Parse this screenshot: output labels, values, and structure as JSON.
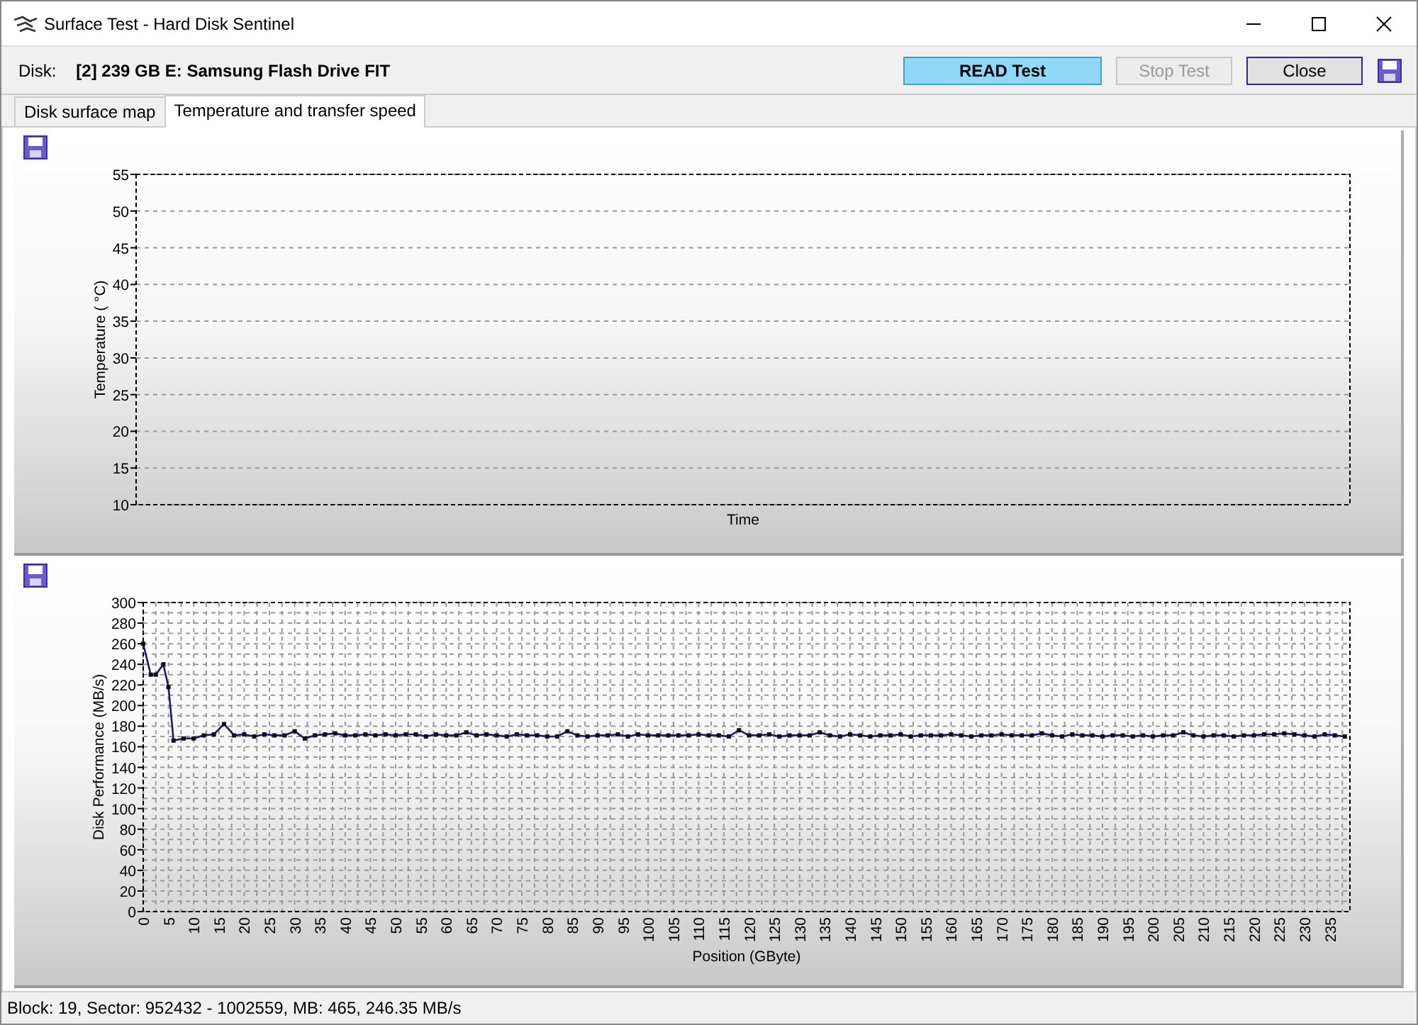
{
  "window": {
    "title": "Surface Test - Hard Disk Sentinel"
  },
  "toolbar": {
    "disk_label": "Disk:",
    "disk_name": "[2] 239 GB E: Samsung Flash Drive FIT",
    "buttons": [
      {
        "label": "READ Test",
        "kind": "highlight",
        "disabled": false
      },
      {
        "label": "Stop Test",
        "kind": "normal",
        "disabled": true
      },
      {
        "label": "Close",
        "kind": "normal",
        "disabled": false
      }
    ]
  },
  "tabs": [
    {
      "label": "Disk surface map",
      "selected": false
    },
    {
      "label": "Temperature and transfer speed",
      "selected": true
    }
  ],
  "panels": [
    {
      "kind": "axes",
      "xlabel": "Time",
      "ylabel": "Temperature ( °C)",
      "y_tick_labels": [
        "55",
        "50",
        "45",
        "40",
        "35",
        "30",
        "25",
        "20",
        "15",
        "10"
      ]
    },
    {
      "kind": "chart",
      "chart_data": {
        "type": "line",
        "xlabel": "Position (GByte)",
        "ylabel": "Disk Performance (MB/s)",
        "xlim": [
          0,
          239
        ],
        "ylim": [
          0,
          300
        ],
        "grid": true,
        "xticks": [
          0,
          5,
          10,
          15,
          20,
          25,
          30,
          35,
          40,
          45,
          50,
          55,
          60,
          65,
          70,
          75,
          80,
          85,
          90,
          95,
          100,
          105,
          110,
          115,
          120,
          125,
          130,
          135,
          140,
          145,
          150,
          155,
          160,
          165,
          170,
          175,
          180,
          185,
          190,
          195,
          200,
          205,
          210,
          215,
          220,
          225,
          230,
          235
        ],
        "yticks": [
          0,
          20,
          40,
          60,
          80,
          100,
          120,
          140,
          160,
          180,
          200,
          220,
          240,
          260,
          280,
          300
        ],
        "x": [
          0,
          1.5,
          2.5,
          4,
          5,
          6,
          8,
          10,
          12,
          14,
          16,
          18,
          20,
          22,
          24,
          26,
          28,
          30,
          32,
          34,
          36,
          38,
          40,
          42,
          44,
          46,
          48,
          50,
          52,
          54,
          56,
          58,
          60,
          62,
          64,
          66,
          68,
          70,
          72,
          74,
          76,
          78,
          80,
          82,
          84,
          86,
          88,
          90,
          92,
          94,
          96,
          98,
          100,
          102,
          104,
          106,
          108,
          110,
          112,
          114,
          116,
          118,
          120,
          122,
          124,
          126,
          128,
          130,
          132,
          134,
          136,
          138,
          140,
          142,
          144,
          146,
          148,
          150,
          152,
          154,
          156,
          158,
          160,
          162,
          164,
          166,
          168,
          170,
          172,
          174,
          176,
          178,
          180,
          182,
          184,
          186,
          188,
          190,
          192,
          194,
          196,
          198,
          200,
          202,
          204,
          206,
          208,
          210,
          212,
          214,
          216,
          218,
          220,
          222,
          224,
          226,
          228,
          230,
          232,
          234,
          236,
          238
        ],
        "series": [
          {
            "color": "#1a1a6e",
            "marker": "square",
            "values": [
              260,
              230,
              230,
              240,
              218,
              166,
              168,
              168,
              171,
              172,
              182,
              171,
              172,
              170,
              172,
              171,
              171,
              175,
              168,
              171,
              172,
              173,
              171,
              171,
              172,
              171,
              172,
              171,
              172,
              172,
              170,
              172,
              171,
              171,
              174,
              171,
              172,
              171,
              170,
              172,
              171,
              171,
              170,
              170,
              175,
              171,
              170,
              171,
              171,
              172,
              170,
              172,
              171,
              171,
              171,
              171,
              171,
              172,
              171,
              171,
              170,
              176,
              171,
              171,
              172,
              170,
              171,
              171,
              171,
              174,
              171,
              170,
              172,
              171,
              170,
              171,
              171,
              172,
              170,
              171,
              171,
              171,
              172,
              171,
              170,
              171,
              171,
              172,
              171,
              171,
              171,
              173,
              171,
              170,
              172,
              171,
              171,
              170,
              171,
              171,
              170,
              171,
              170,
              171,
              171,
              174,
              171,
              170,
              171,
              171,
              170,
              171,
              171,
              172,
              172,
              173,
              172,
              171,
              170,
              172,
              171,
              170
            ]
          }
        ]
      }
    }
  ],
  "status_bar": {
    "text": "Block: 19, Sector: 952432 - 1002559, MB: 465, 246.35 MB/s"
  }
}
